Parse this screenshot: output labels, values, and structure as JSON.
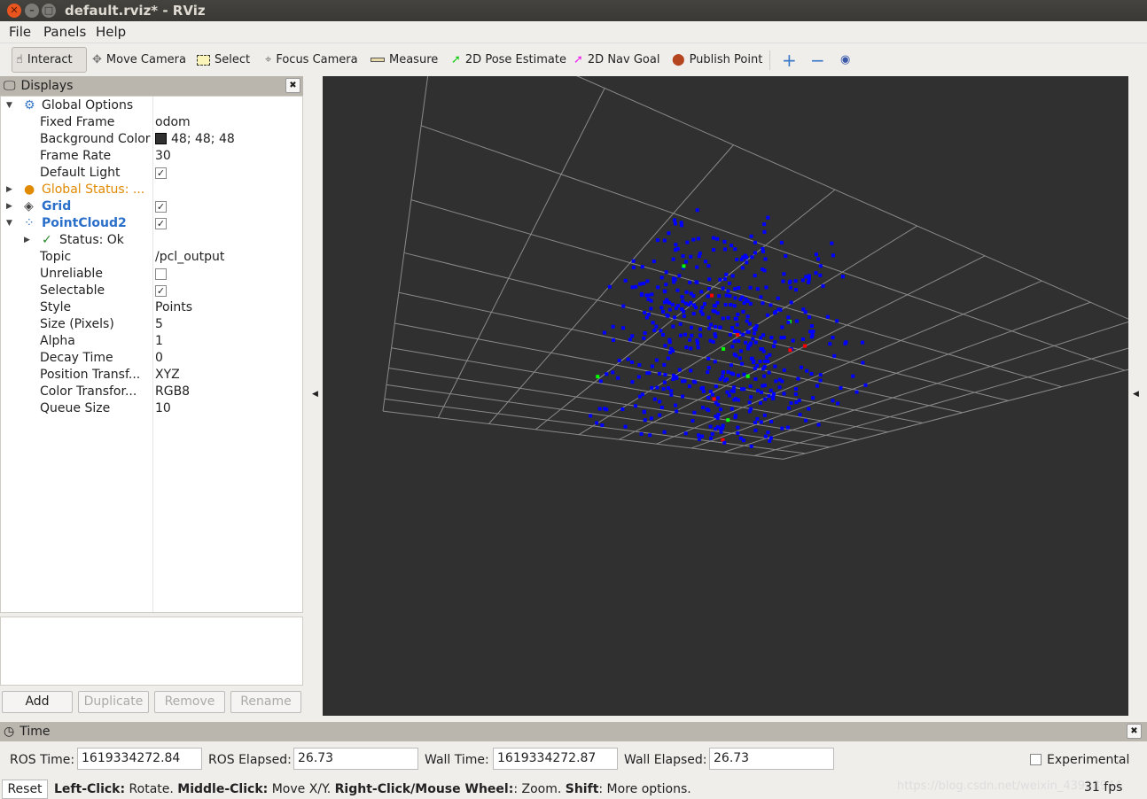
{
  "window": {
    "title": "default.rviz* - RViz"
  },
  "menu": [
    "File",
    "Panels",
    "Help"
  ],
  "toolbar": {
    "tools": [
      {
        "label": "Interact",
        "icon": "hand-icon"
      },
      {
        "label": "Move Camera",
        "icon": "move-icon"
      },
      {
        "label": "Select",
        "icon": "select-rect-icon"
      },
      {
        "label": "Focus Camera",
        "icon": "crosshair-icon"
      },
      {
        "label": "Measure",
        "icon": "ruler-icon"
      },
      {
        "label": "2D Pose Estimate",
        "icon": "green-arrow-icon"
      },
      {
        "label": "2D Nav Goal",
        "icon": "magenta-arrow-icon"
      },
      {
        "label": "Publish Point",
        "icon": "map-pin-icon"
      }
    ],
    "extra": [
      "plus-icon",
      "minus-icon",
      "eye-icon"
    ]
  },
  "displays": {
    "title": "Displays",
    "rows": [
      {
        "key": "Global Options",
        "value": "",
        "indent": 0,
        "expand": "open",
        "icon": "gear-icon"
      },
      {
        "key": "Fixed Frame",
        "value": "odom",
        "indent": 1
      },
      {
        "key": "Background Color",
        "value": "48; 48; 48",
        "indent": 1,
        "swatch": "#303030"
      },
      {
        "key": "Frame Rate",
        "value": "30",
        "indent": 1
      },
      {
        "key": "Default Light",
        "value": "",
        "indent": 1,
        "check": true
      },
      {
        "key": "Global Status: ...",
        "value": "",
        "indent": 0,
        "expand": "closed",
        "icon": "warning-icon",
        "color": "#e08a00"
      },
      {
        "key": "Grid",
        "value": "",
        "indent": 0,
        "expand": "closed",
        "icon": "grid-icon",
        "color": "#2a6fc9",
        "bold": true,
        "check": true
      },
      {
        "key": "PointCloud2",
        "value": "",
        "indent": 0,
        "expand": "open",
        "icon": "pointcloud-icon",
        "color": "#2a6fc9",
        "bold": true,
        "check": true
      },
      {
        "key": "Status: Ok",
        "value": "",
        "indent": 1,
        "expand": "closed",
        "icon": "check-icon"
      },
      {
        "key": "Topic",
        "value": "/pcl_output",
        "indent": 1
      },
      {
        "key": "Unreliable",
        "value": "",
        "indent": 1,
        "check": false
      },
      {
        "key": "Selectable",
        "value": "",
        "indent": 1,
        "check": true
      },
      {
        "key": "Style",
        "value": "Points",
        "indent": 1
      },
      {
        "key": "Size (Pixels)",
        "value": "5",
        "indent": 1
      },
      {
        "key": "Alpha",
        "value": "1",
        "indent": 1
      },
      {
        "key": "Decay Time",
        "value": "0",
        "indent": 1
      },
      {
        "key": "Position Transf...",
        "value": "XYZ",
        "indent": 1
      },
      {
        "key": "Color Transfor...",
        "value": "RGB8",
        "indent": 1
      },
      {
        "key": "Queue Size",
        "value": "10",
        "indent": 1
      }
    ],
    "buttons": [
      "Add",
      "Duplicate",
      "Remove",
      "Rename"
    ]
  },
  "view": {
    "background": "#303030",
    "point_color": "#0000ff",
    "highlight_colors": [
      "#ff0000",
      "#00ff00"
    ]
  },
  "time": {
    "title": "Time",
    "ros_time_label": "ROS Time:",
    "ros_time": "1619334272.84",
    "ros_elapsed_label": "ROS Elapsed:",
    "ros_elapsed": "26.73",
    "wall_time_label": "Wall Time:",
    "wall_time": "1619334272.87",
    "wall_elapsed_label": "Wall Elapsed:",
    "wall_elapsed": "26.73",
    "experimental": "Experimental"
  },
  "status": {
    "reset": "Reset",
    "hints": [
      [
        "Left-Click:",
        " Rotate. "
      ],
      [
        "Middle-Click:",
        " Move X/Y. "
      ],
      [
        "Right-Click/Mouse Wheel:",
        ": Zoom. "
      ],
      [
        "Shift",
        ": More options."
      ]
    ],
    "fps": "31 fps",
    "watermark": "https://blog.csdn.net/weixin_43928944"
  }
}
